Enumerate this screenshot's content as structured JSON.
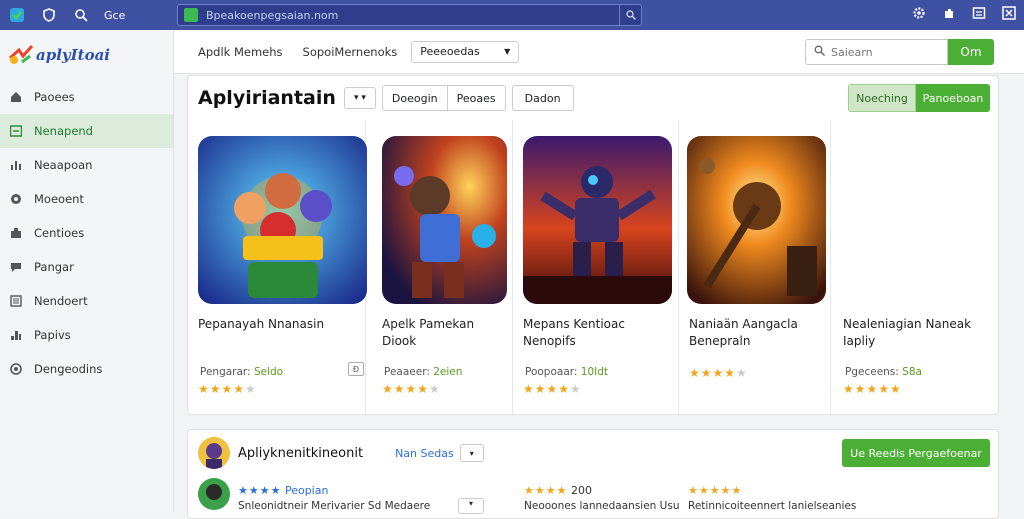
{
  "titlebar": {
    "left_text": "Gce",
    "address": "Bpeakoenpegsaian.nom",
    "right_icons": [
      "gear-icon",
      "puzzle-icon",
      "window-icon",
      "close-icon"
    ]
  },
  "sidebar": {
    "logo_text": "aplyItoai",
    "items": [
      {
        "label": "Paoees",
        "icon": "home-icon"
      },
      {
        "label": "Nenapend",
        "icon": "grid-icon",
        "active": true
      },
      {
        "label": "Neaapoan",
        "icon": "chart-icon"
      },
      {
        "label": "Moeoent",
        "icon": "circle-icon"
      },
      {
        "label": "Centioes",
        "icon": "puzzle-icon"
      },
      {
        "label": "Pangar",
        "icon": "chat-icon"
      },
      {
        "label": "Nendoert",
        "icon": "list-icon"
      },
      {
        "label": "Papivs",
        "icon": "bar-icon"
      },
      {
        "label": "Dengeodins",
        "icon": "dot-icon"
      }
    ]
  },
  "topnav": {
    "links": [
      "Apdlk Memehs",
      "SopoiMernenoks"
    ],
    "select_value": "Peeeoedas",
    "search_placeholder": "Saiearn",
    "search_button": "Om"
  },
  "main_card": {
    "title": "Aplyiriantain",
    "tabs": [
      "Doeogin",
      "Peoaes"
    ],
    "tab3": "Dadon",
    "action_a": "Noeching",
    "action_b": "Panoeboan",
    "apps": [
      {
        "name": "Pepanayah Nnanasin",
        "meta_label": "Pengarar:",
        "meta_value": "Seldo",
        "rating": 4,
        "badge": "Ð"
      },
      {
        "name": "Apelk Pamekan Diook",
        "meta_label": "Peaaeer:",
        "meta_value": "2eien",
        "rating": 4
      },
      {
        "name": "Mepans Kentioac Nenopifs",
        "meta_label": "Poopoaar:",
        "meta_value": "10Idt",
        "rating": 4
      },
      {
        "name": "Naniaän Aangacla Benepraln",
        "meta_label": "",
        "meta_value": "",
        "rating": 4
      },
      {
        "name": "Nealeniagian Naneak Iapliy",
        "meta_label": "Pgeceens:",
        "meta_value": "S8a",
        "rating": 5
      }
    ]
  },
  "bottom_card": {
    "title": "Apliyknenitkineonit",
    "link": "Nan Sedas",
    "button": "Ue Reedis Pergaefoenar",
    "row_items": [
      {
        "stars": "★★★★",
        "text": "Peopian",
        "sub": "Snleonidtneir Merivarier Sd Medaere"
      },
      {
        "stars": "★★★★",
        "text": "200",
        "sub": "Neooones lannedaansien Usu"
      },
      {
        "stars": "★★★★★",
        "text": "",
        "sub": "Retinnicoiteennert lanielseanies"
      }
    ]
  }
}
